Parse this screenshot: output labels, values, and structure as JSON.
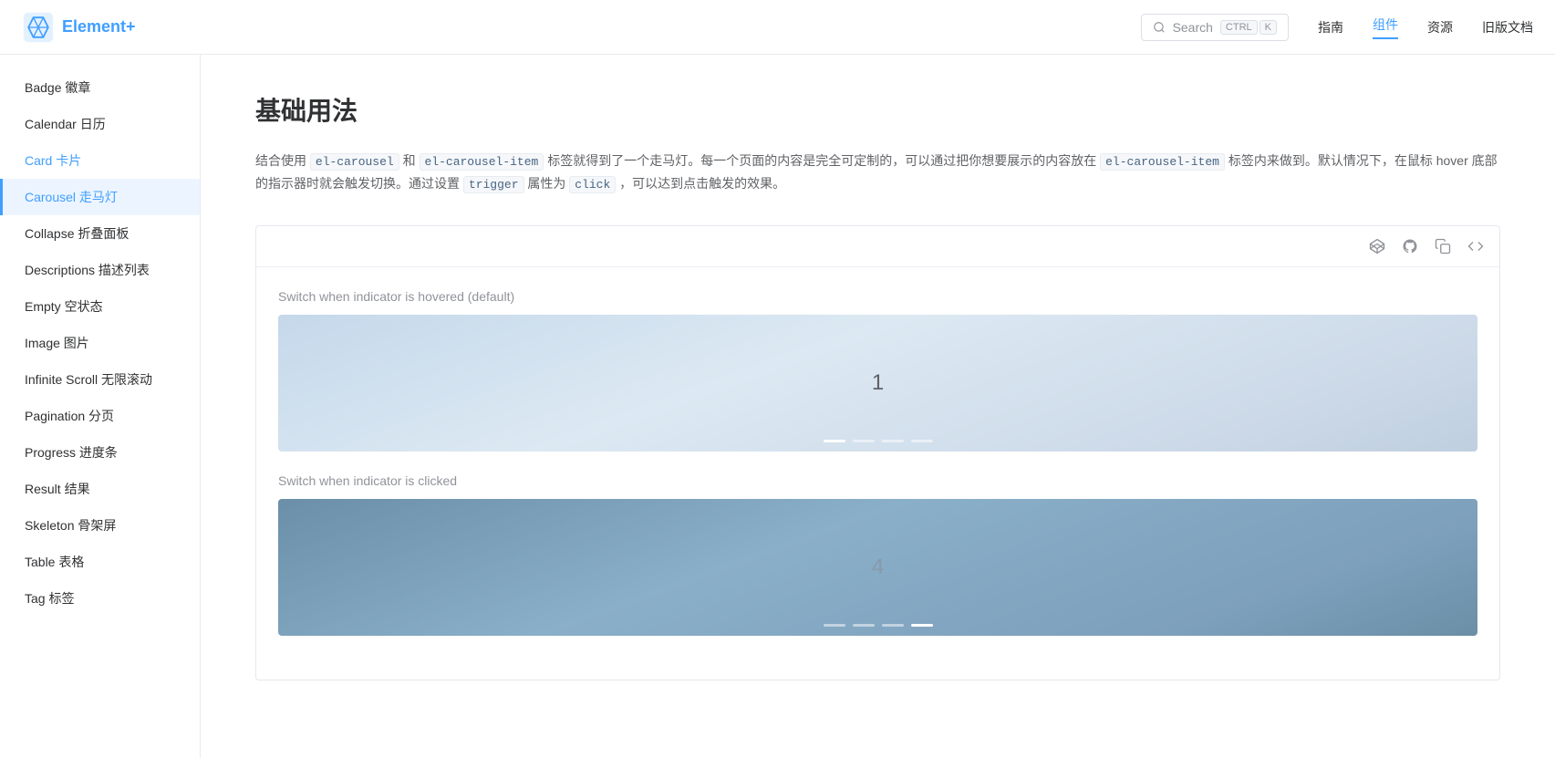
{
  "header": {
    "logo_text": "Element+",
    "search_label": "Search",
    "kbd_ctrl": "CTRL",
    "kbd_k": "K",
    "nav": [
      {
        "id": "guide",
        "label": "指南",
        "active": false
      },
      {
        "id": "components",
        "label": "组件",
        "active": true
      },
      {
        "id": "resources",
        "label": "资源",
        "active": false
      },
      {
        "id": "legacy",
        "label": "旧版文档",
        "active": false
      }
    ]
  },
  "sidebar": {
    "items": [
      {
        "id": "badge",
        "label": "Badge 徽章",
        "active": false
      },
      {
        "id": "calendar",
        "label": "Calendar 日历",
        "active": false
      },
      {
        "id": "card",
        "label": "Card 卡片",
        "active": false
      },
      {
        "id": "carousel",
        "label": "Carousel 走马灯",
        "active": true
      },
      {
        "id": "collapse",
        "label": "Collapse 折叠面板",
        "active": false
      },
      {
        "id": "descriptions",
        "label": "Descriptions 描述列表",
        "active": false
      },
      {
        "id": "empty",
        "label": "Empty 空状态",
        "active": false
      },
      {
        "id": "image",
        "label": "Image 图片",
        "active": false
      },
      {
        "id": "infinite-scroll",
        "label": "Infinite Scroll 无限滚动",
        "active": false
      },
      {
        "id": "pagination",
        "label": "Pagination 分页",
        "active": false
      },
      {
        "id": "progress",
        "label": "Progress 进度条",
        "active": false
      },
      {
        "id": "result",
        "label": "Result 结果",
        "active": false
      },
      {
        "id": "skeleton",
        "label": "Skeleton 骨架屏",
        "active": false
      },
      {
        "id": "table",
        "label": "Table 表格",
        "active": false
      },
      {
        "id": "tag",
        "label": "Tag 标签",
        "active": false
      }
    ]
  },
  "main": {
    "page_title": "基础用法",
    "description_parts": [
      {
        "type": "text",
        "content": "结合使用 "
      },
      {
        "type": "code",
        "content": "el-carousel"
      },
      {
        "type": "text",
        "content": " 和 "
      },
      {
        "type": "code",
        "content": "el-carousel-item"
      },
      {
        "type": "text",
        "content": " 标签就得到了一个走马灯。每一个页面的内容是完全可定制的，可以通过把你想要展示的内容放在 "
      },
      {
        "type": "code",
        "content": "el-carousel-item"
      },
      {
        "type": "text",
        "content": " 标签内来做到。默认情况下，在鼠标 hover 底部的指示器时就会触发切换。通过设置 "
      },
      {
        "type": "code",
        "content": "trigger"
      },
      {
        "type": "text",
        "content": " 属性为 "
      },
      {
        "type": "code",
        "content": "click"
      },
      {
        "type": "text",
        "content": " ，可以达到点击触发的效果。"
      }
    ],
    "carousel_1": {
      "label": "Switch when indicator is hovered (default)",
      "slide_number": "1",
      "indicators": [
        {
          "active": true
        },
        {
          "active": false
        },
        {
          "active": false
        },
        {
          "active": false
        }
      ]
    },
    "carousel_2": {
      "label": "Switch when indicator is clicked",
      "slide_number": "4",
      "indicators": [
        {
          "active": false
        },
        {
          "active": false
        },
        {
          "active": false
        },
        {
          "active": true
        }
      ]
    }
  },
  "toolbar": {
    "icons": [
      {
        "id": "codepen",
        "symbol": "⊕",
        "title": "CodePen"
      },
      {
        "id": "github",
        "symbol": "⊙",
        "title": "GitHub"
      },
      {
        "id": "copy",
        "symbol": "⧉",
        "title": "Copy"
      },
      {
        "id": "code",
        "symbol": "<>",
        "title": "View Code"
      }
    ]
  }
}
